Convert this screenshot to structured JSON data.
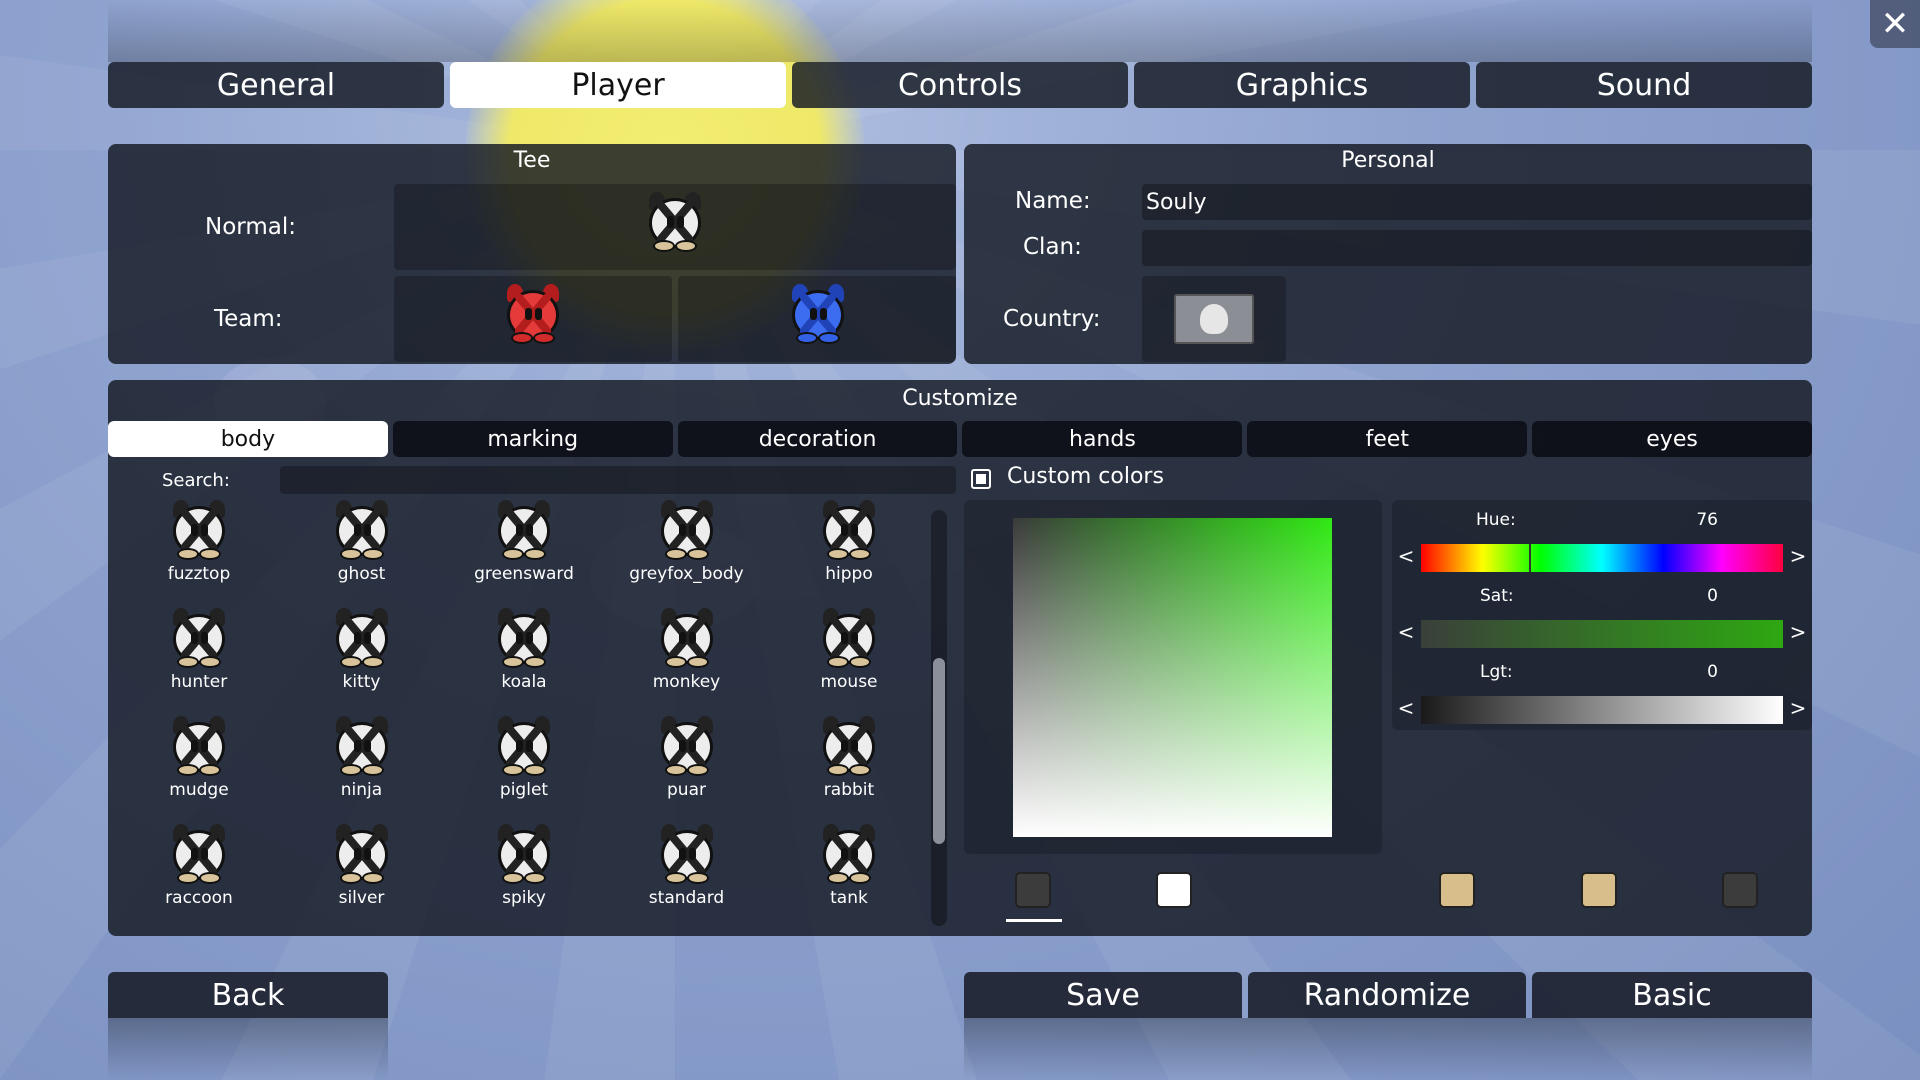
{
  "colors": {
    "panel_bg": "#141822",
    "tab_active_bg": "#ffffff",
    "tab_active_text": "#111111",
    "sky": "#8fa3cf",
    "sun": "#f2ee72"
  },
  "window": {
    "close_icon": "close-icon"
  },
  "tabs": [
    {
      "label": "General",
      "active": false
    },
    {
      "label": "Player",
      "active": true
    },
    {
      "label": "Controls",
      "active": false
    },
    {
      "label": "Graphics",
      "active": false
    },
    {
      "label": "Sound",
      "active": false
    }
  ],
  "tee": {
    "title": "Tee",
    "normal_label": "Normal:",
    "team_label": "Team:"
  },
  "personal": {
    "title": "Personal",
    "name_label": "Name:",
    "name_value": "Souly",
    "clan_label": "Clan:",
    "clan_value": "",
    "country_label": "Country:",
    "country_flag_icon": "default-flag-icon"
  },
  "customize": {
    "title": "Customize",
    "parts": [
      {
        "label": "body",
        "active": true
      },
      {
        "label": "marking",
        "active": false
      },
      {
        "label": "decoration",
        "active": false
      },
      {
        "label": "hands",
        "active": false
      },
      {
        "label": "feet",
        "active": false
      },
      {
        "label": "eyes",
        "active": false
      }
    ],
    "search_label": "Search:",
    "search_value": "",
    "custom_colors_label": "Custom colors",
    "custom_colors_checked": true,
    "skins": [
      "fuzztop",
      "ghost",
      "greensward",
      "greyfox_body",
      "hippo",
      "hunter",
      "kitty",
      "koala",
      "monkey",
      "mouse",
      "mudge",
      "ninja",
      "piglet",
      "puar",
      "rabbit",
      "raccoon",
      "silver",
      "spiky",
      "standard",
      "tank"
    ],
    "scroll_position": 0.36,
    "sliders": {
      "hue": {
        "label": "Hue:",
        "value": "76"
      },
      "sat": {
        "label": "Sat:",
        "value": "0"
      },
      "lgt": {
        "label": "Lgt:",
        "value": "0"
      },
      "left_arrow": "<",
      "right_arrow": ">"
    },
    "swatches": [
      "#3c3c3c",
      "#ffffff",
      "#d8be8a",
      "#d8be8a",
      "#3c3c3c"
    ]
  },
  "bottom": {
    "back_label": "Back",
    "save_label": "Save",
    "randomize_label": "Randomize",
    "basic_label": "Basic"
  }
}
